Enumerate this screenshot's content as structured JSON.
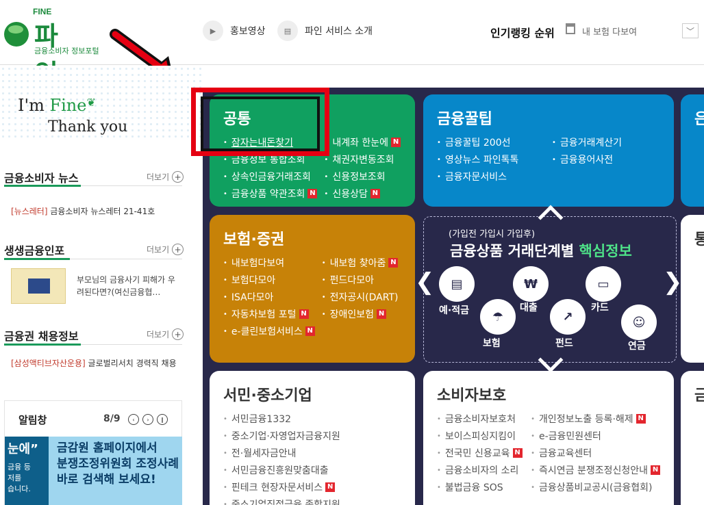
{
  "header": {
    "logo_top": "FINE",
    "logo_name": "파 인",
    "logo_sub": "금융소비자 정보포털",
    "promo_video": "홍보영상",
    "service_intro": "파인 서비스 소개",
    "ranking_label": "인기랭킹 순위",
    "ranking_item": "내 보험 다보여",
    "video_icon": "▶",
    "intro_icon": "▤",
    "dropdown_icon": "﹀"
  },
  "sidebar": {
    "im": "I'm ",
    "fine": "Fine",
    "thank": "Thank you",
    "more": "더보기",
    "plus": "+",
    "news_title": "금융소비자 뉴스",
    "news_tag": "[뉴스레터]",
    "news_text": " 금융소비자 뉴스레터 21-41호",
    "life_title": "생생금융인포",
    "life_text": "부모님의 금융사기 피해가 우려된다면?(여신금융협…",
    "job_title": "금융권 채용정보",
    "job_tag": "[삼성액티브자산운용]",
    "job_text": " 글로벌리서치 경력직 채용",
    "alarm_title": "알림창",
    "alarm_page": "8/9",
    "alarm_prev": "‹",
    "alarm_next": "›",
    "alarm_pause": "∥",
    "alarm_dark_big": "눈에”",
    "alarm_dark_line1": "금융 등",
    "alarm_dark_line2": "저를",
    "alarm_dark_line3": "습니다.",
    "alarm_light_line1": "금감원 홈페이지에서",
    "alarm_light_line2": "분쟁조정위원회 조정사례",
    "alarm_light_line3": "바로 검색해 보세요!"
  },
  "cards": {
    "common": {
      "title": "공통",
      "items": [
        "잠자는내돈찾기",
        "내계좌 한눈에",
        "금융정보 통합조회",
        "채권자변동조회",
        "상속인금융거래조회",
        "신용정보조회",
        "금융상품 약관조회",
        "신용상담"
      ]
    },
    "tips": {
      "title": "금융꿀팁",
      "items": [
        "금융꿀팁 200선",
        "금융거래계산기",
        "영상뉴스 파인톡톡",
        "금융용어사전",
        "금융자문서비스"
      ]
    },
    "insurance": {
      "title": "보험·증권",
      "items": [
        "내보험다보여",
        "내보험 찾아줌",
        "보험다모아",
        "펀드다모아",
        "ISA다모아",
        "전자공시(DART)",
        "자동차보험 포털",
        "장애인보험",
        "e-클린보험서비스"
      ]
    },
    "sme": {
      "title": "서민·중소기업",
      "items": [
        "서민금융1332",
        "중소기업·자영업자금융지원",
        "전·월세자금안내",
        "서민금융진흥원맞춤대출",
        "핀테크 현장자문서비스",
        "중소기업직접금융 종합지원"
      ]
    },
    "consumer": {
      "title": "소비자보호",
      "items": [
        "금융소비자보호처",
        "개인정보노출 등록·해제",
        "보이스피싱지킴이",
        "e-금융민원센터",
        "전국민 신용교육",
        "금융교육센터",
        "금융소비자의 소리",
        "즉시연금 분쟁조정신청안내",
        "불법금융 SOS",
        "금융상품비교공시(금융협회)"
      ]
    },
    "right_top_title": "은",
    "right_mid_title": "통",
    "right_bot_title": "금",
    "new_badge": "N"
  },
  "center": {
    "subtitle": "(가입전 가입시 가입후)",
    "title_main": "금융상품 거래단계별 ",
    "title_highlight": "핵심정보",
    "prev": "❮",
    "next": "❯",
    "icons": [
      {
        "label": "예·적금",
        "symbol": "▤"
      },
      {
        "label": "대출",
        "symbol": "₩"
      },
      {
        "label": "카드",
        "symbol": "▭"
      },
      {
        "label": "보험",
        "symbol": "☂"
      },
      {
        "label": "펀드",
        "symbol": "↗"
      },
      {
        "label": "연금",
        "symbol": "☺"
      }
    ]
  },
  "colors": {
    "green": "#10a060",
    "blue": "#0787c9",
    "orange": "#c78208",
    "navy": "#28284a",
    "highlight_red": "#e50012"
  }
}
